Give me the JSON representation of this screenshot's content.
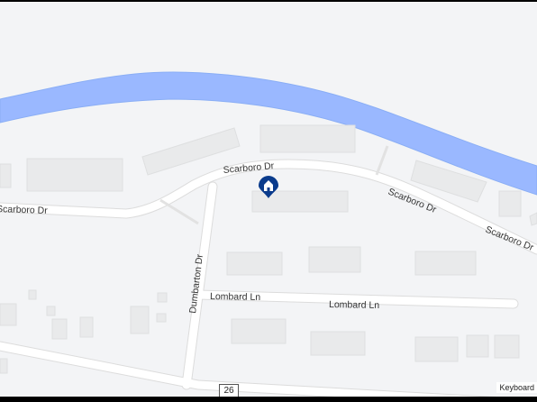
{
  "map": {
    "water_color": "#9ab8ff",
    "road_color": "#ffffff",
    "building_color": "#e9eaeb",
    "pin_color": "#0a3b8c",
    "pin_icon": "home-icon"
  },
  "streets": {
    "scarboro_1": "Scarboro Dr",
    "scarboro_2": "Scarboro Dr",
    "scarboro_3": "Scarboro Dr",
    "scarboro_4": "Scarboro Dr",
    "dumbarton": "Dumbarton Dr",
    "lombard_1": "Lombard Ln",
    "lombard_2": "Lombard Ln"
  },
  "route_shield": "26",
  "attribution": "Keyboard"
}
